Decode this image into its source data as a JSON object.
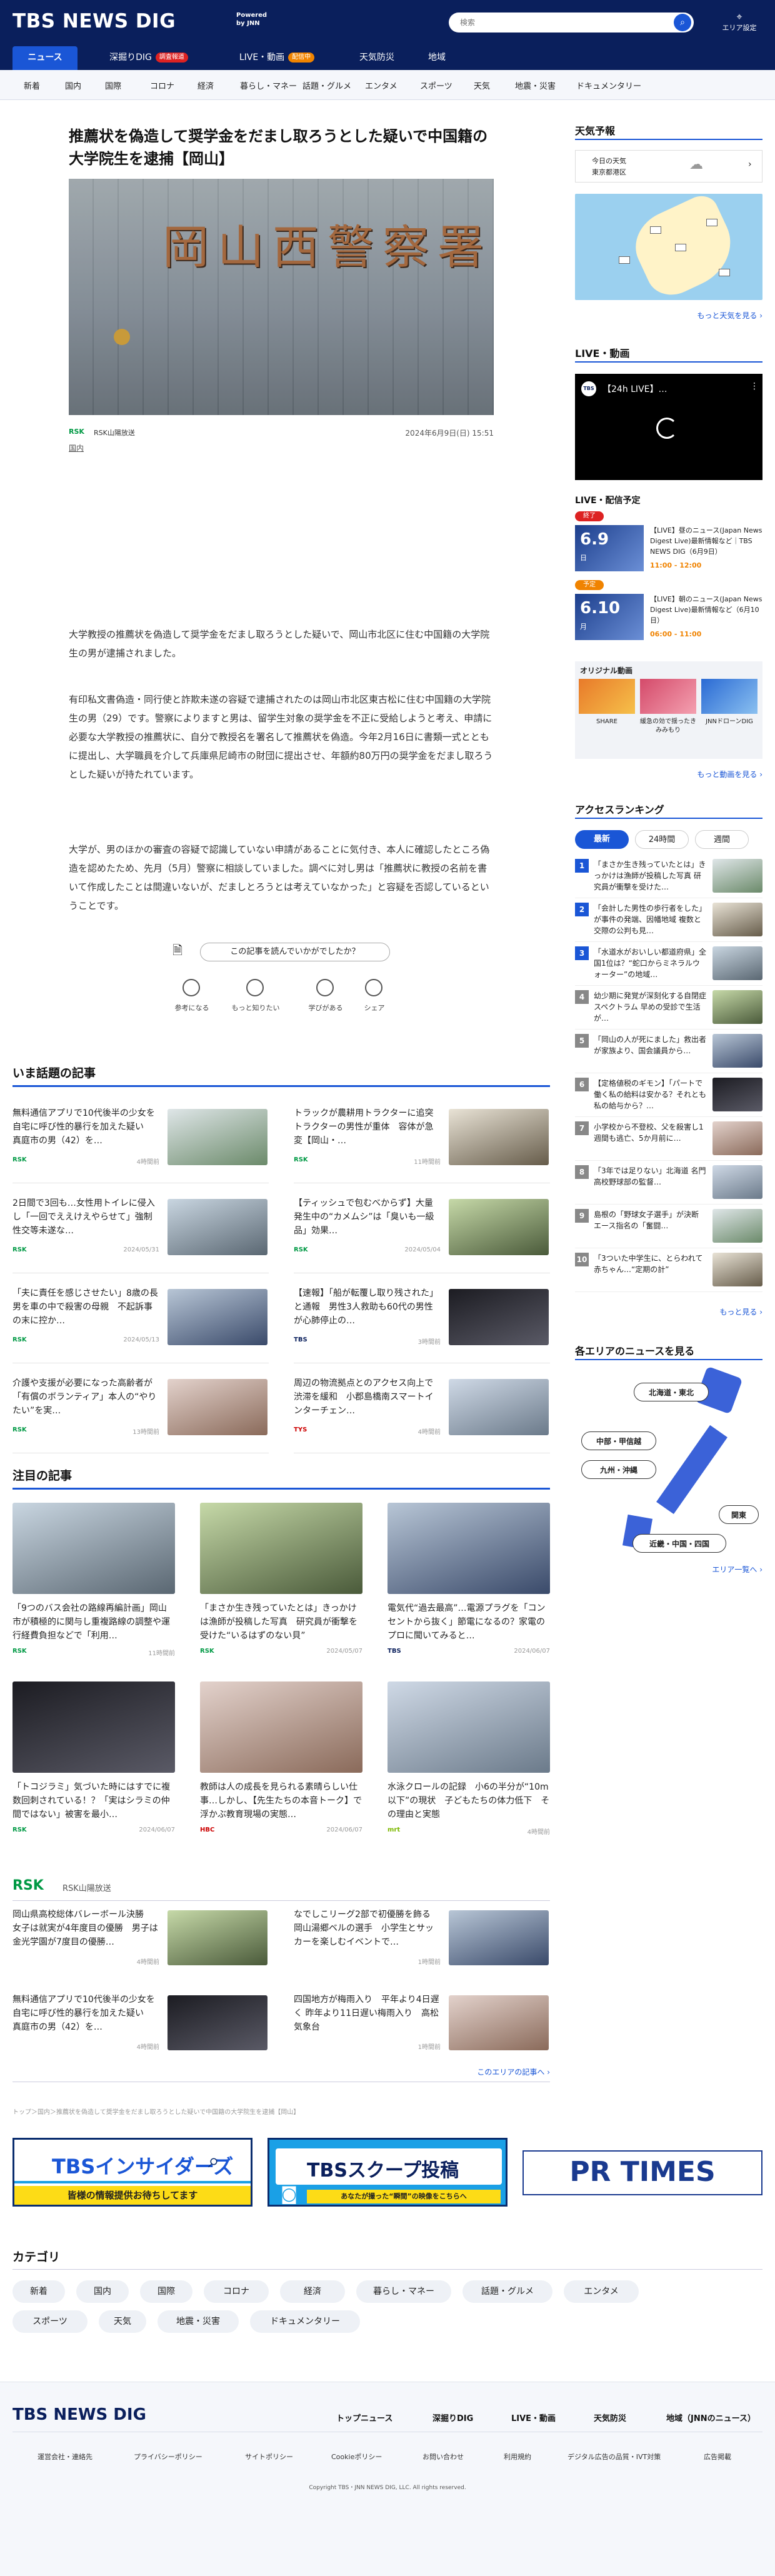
{
  "header": {
    "logo": "TBS NEWS DIG",
    "powered": [
      "Powered",
      "by JNN"
    ],
    "search_placeholder": "検索",
    "area_label": "エリア設定"
  },
  "tabs": [
    {
      "label": "ニュース"
    },
    {
      "label": "深掘りDIG",
      "badge": "調査報道"
    },
    {
      "label": "LIVE・動画",
      "badge": "配信中"
    },
    {
      "label": "天気防災"
    },
    {
      "label": "地域"
    }
  ],
  "categories": [
    "新着",
    "国内",
    "国際",
    "コロナ",
    "経済",
    "暮らし・マネー",
    "話題・グルメ",
    "エンタメ",
    "スポーツ",
    "天気",
    "地震・災害",
    "ドキュメンタリー"
  ],
  "article": {
    "title": "推薦状を偽造して奨学金をだまし取ろうとした疑いで中国籍の大学院生を逮捕【岡山】",
    "sign": "岡山西警察署",
    "source": "RSK山陽放送",
    "source_logo": "RSK",
    "date": "2024年6月9日(日) 15:51",
    "tag": "国内",
    "paragraphs": [
      "大学教授の推薦状を偽造して奨学金をだまし取ろうとした疑いで、岡山市北区に住む中国籍の大学院生の男が逮捕されました。",
      "有印私文書偽造・同行使と詐欺未遂の容疑で逮捕されたのは岡山市北区東古松に住む中国籍の大学院生の男（29）です。警察によりますと男は、留学生対象の奨学金を不正に受給しようと考え、申請に必要な大学教授の推薦状に、自分で教授名を署名して推薦状を偽造。今年2月16日に書類一式とともに提出し、大学職員を介して兵庫県尼崎市の財団に提出させ、年額約80万円の奨学金をだまし取ろうとした疑いが持たれています。",
      "大学が、男のほかの審査の容疑で認識していない申請があることに気付き、本人に確認したところ偽造を認めたため、先月（5月）警察に相談していました。調べに対し男は「推薦状に教授の名前を書いて作成したことは間違いないが、だましとろうとは考えていなかった」と容疑を否認しているということです。"
    ],
    "feedback_q": "この記事を読んでいかがでしたか？",
    "reactions": [
      "参考になる",
      "もっと知りたい",
      "学びがある",
      "シェア"
    ]
  },
  "trending": {
    "heading": "いま話題の記事",
    "items": [
      {
        "title": "無料通信アプリで10代後半の少女を自宅に呼び性的暴行を加えた疑い　真庭市の男（42）を…",
        "src": "RSK",
        "date": "4時間前"
      },
      {
        "title": "トラックが農耕用トラクターに追突　トラクターの男性が重体　容体が急変【岡山・…",
        "src": "RSK",
        "date": "11時間前"
      },
      {
        "title": "2日間で3回も…女性用トイレに侵入し「一回でええけえやらせて」強制性交等未遂な…",
        "src": "RSK",
        "date": "2024/05/31"
      },
      {
        "title": "【ティッシュで包むべからず】大量発生中の“カメムシ”は「臭いも一級品」効果…",
        "src": "RSK",
        "date": "2024/05/04"
      },
      {
        "title": "「夫に責任を感じさせたい」8歳の長男を車の中で殺害の母親　不起訴事の末に控か…",
        "src": "RSK",
        "date": "2024/05/13"
      },
      {
        "title": "【速報】「船が転覆し取り残された」と通報　男性3人救助も60代の男性が心肺停止の…",
        "src": "TBS",
        "date": "3時間前"
      },
      {
        "title": "介護や支援が必要になった高齢者が「有償のボランティア」本人の“やりたい”を実…",
        "src": "RSK",
        "date": "13時間前"
      },
      {
        "title": "周辺の物流拠点とのアクセス向上で渋滞を緩和　小郡島橋南スマートインターチェン…",
        "src": "TYS",
        "date": "4時間前"
      }
    ]
  },
  "featured": {
    "heading": "注目の記事",
    "items": [
      {
        "title": "「9つのバス会社の路線再編計画」岡山市が積極的に関与し重複路線の調整や運行経費負担などで「利用…",
        "src": "RSK",
        "date": "11時間前"
      },
      {
        "title": "「まさか生き残っていたとは」きっかけは漁師が投稿した写真　研究員が衝撃を受けた“いるはずのない貝”",
        "src": "RSK",
        "date": "2024/05/07"
      },
      {
        "title": "電気代“過去最高”…電源プラグを「コンセントから抜く」節電になるの？家電のプロに聞いてみると…",
        "src": "TBS",
        "date": "2024/06/07"
      },
      {
        "title": "「トコジラミ」気づいた時にはすでに複数回刺されている！？「実はシラミの仲間ではない」被害を最小…",
        "src": "RSK",
        "date": "2024/06/07"
      },
      {
        "title": "教師は人の成長を見られる素晴らしい仕事…しかし、【先生たちの本音トーク】で浮かぶ教育現場の実態…",
        "src": "HBC",
        "date": "2024/06/07"
      },
      {
        "title": "水泳クロールの記録　小6の半分が“10m以下”の現状　子どもたちの体力低下　その理由と実態",
        "src": "mrt",
        "date": "4時間前"
      }
    ]
  },
  "rsk": {
    "logo": "RSK",
    "name": "RSK山陽放送",
    "items": [
      {
        "title": "岡山県高校総体バレーボール決勝　女子は就実が4年度目の優勝　男子は金光学園が7度目の優勝…",
        "date": "4時間前"
      },
      {
        "title": "なでしこリーグ2部で初優勝を飾る　岡山湯郷ベルの選手　小学生とサッカーを楽しむイベントで…",
        "date": "1時間前"
      },
      {
        "title": "無料通信アプリで10代後半の少女を自宅に呼び性的暴行を加えた疑い　真庭市の男（42）を…",
        "date": "4時間前"
      },
      {
        "title": "四国地方が梅雨入り　平年より4日遅く 昨年より11日遅い梅雨入り　高松気象台",
        "date": "1時間前"
      }
    ],
    "more": "このエリアの記事へ ›"
  },
  "breadcrumb": "トップ＞国内＞推薦状を偽造して奨学金をだまし取ろうとした疑いで中国籍の大学院生を逮捕【岡山】",
  "banners": [
    {
      "text": "TBSインサイダーズ",
      "sub": "皆様の情報提供お待ちしてます"
    },
    {
      "text": "TBSスクープ投稿",
      "sub": "あなたが撮った“瞬間”の映像をこちらへ"
    },
    {
      "text": "PR TIMES"
    }
  ],
  "category_sec": {
    "heading": "カテゴリ",
    "items": [
      "新着",
      "国内",
      "国際",
      "コロナ",
      "経済",
      "暮らし・マネー",
      "話題・グルメ",
      "エンタメ",
      "スポーツ",
      "天気",
      "地震・災害",
      "ドキュメンタリー"
    ]
  },
  "sidebar": {
    "weather_h": "天気予報",
    "weather_loc": [
      "今日の天気",
      "東京都港区"
    ],
    "weather_more": "もっと天気を見る ›",
    "live_h": "LIVE・動画",
    "live_title": "【24h LIVE】…",
    "sched_h": "LIVE・配信予定",
    "sched": [
      {
        "state": "終了",
        "date": "6.9",
        "dow": "日",
        "title": "【LIVE】昼のニュース(Japan News Digest Live)最新情報など｜TBS NEWS DIG（6月9日）",
        "time": "11:00 - 12:00"
      },
      {
        "state": "予定",
        "date": "6.10",
        "dow": "月",
        "title": "【LIVE】朝のニュース(Japan News Digest Live)最新情報など（6月10日）",
        "time": "06:00 - 11:00"
      }
    ],
    "orig_h": "オリジナル動画",
    "orig": [
      "SHARE",
      "緩急の効で揺ったきみみもり",
      "JNNドローンDIG"
    ],
    "orig_more": "もっと動画を見る ›",
    "rank_h": "アクセスランキング",
    "rank_tabs": [
      "最新",
      "24時間",
      "週間"
    ],
    "rank": [
      "「まさか生き残っていたとは」きっかけは漁師が投稿した写真 研究員が衝撃を受けた…",
      "「会計した男性の歩行者をした」が事件の発端、因幡地域 複数と交際の公判も見…",
      "「水道水がおいしい都道府県」全国1位は？“蛇口からミネラルウォーター”の地域…",
      "幼少期に発覚が深刻化する自閉症スペクトラム 早めの受診で生活が…",
      "「岡山の人が死にました」救出者が家族より、国会議員から…",
      "【定格値税のギモン】「パートで働く私の給料は安かる？それとも私の給与から？…",
      "小学校から不登校、父を殺害し1週間も逃亡、5か月前に…",
      "「3年では足りない」北海道 名門高校野球部の監督…",
      "島根の「野球女子選手」が決断 エース指名の「奮闘…",
      "「3ついた中学生に、とらわれて赤ちゃん…“定期の計”"
    ],
    "rank_more": "もっと見る ›",
    "area_h": "各エリアのニュースを見る",
    "areas": [
      "北海道・東北",
      "中部・甲信越",
      "九州・沖縄",
      "関東",
      "近畿・中国・四国"
    ],
    "area_more": "エリア一覧へ ›"
  },
  "footer": {
    "logo": "TBS NEWS DIG",
    "links": [
      "トップニュース",
      "深掘りDIG",
      "LIVE・動画",
      "天気防災",
      "地域（JNNのニュース）"
    ],
    "small": [
      "運営会社・連絡先",
      "プライバシーポリシー",
      "サイトポリシー",
      "Cookieポリシー",
      "お問い合わせ",
      "利用規約",
      "デジタル広告の品質・IVT対策",
      "広告掲載"
    ],
    "copyright": "Copyright TBS・JNN NEWS DIG, LLC. All rights reserved."
  },
  "colors": {
    "navy": "#0a1f5c",
    "blue": "#1a56d6",
    "rsk_green": "#009944",
    "orange": "#f08300"
  }
}
